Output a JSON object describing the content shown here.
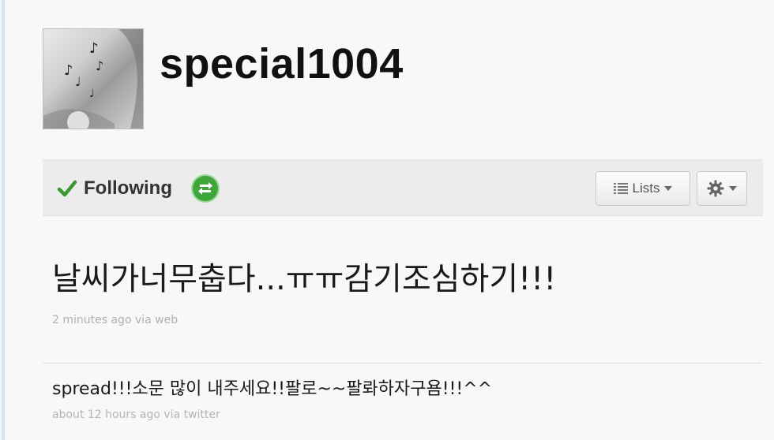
{
  "profile": {
    "screen_name": "special1004",
    "avatar_icon": "profile-photo"
  },
  "follow_bar": {
    "following_label": "Following",
    "check_icon": "check-icon",
    "retweet_icon": "retweet-toggle-icon",
    "lists_label": "Lists",
    "lists_icon": "list-icon",
    "gear_icon": "gear-icon",
    "colors": {
      "check": "#3a9a2f",
      "retweet": "#3fa63a"
    }
  },
  "tweets": [
    {
      "text": "날씨가너무춥다...ㅠㅠ감기조심하기!!!",
      "meta": "2 minutes ago via web"
    },
    {
      "text": "spread!!!소문 많이 내주세요!!팔로~~팔롸하자구욤!!!^^",
      "meta": "about 12 hours ago via twitter"
    }
  ]
}
